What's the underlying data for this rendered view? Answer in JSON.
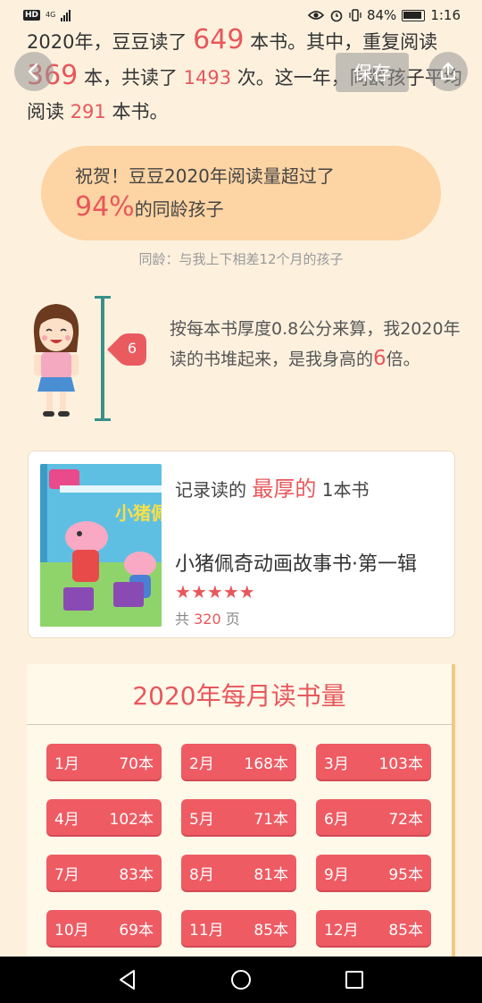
{
  "status_bar": {
    "hd": "HD",
    "network": "4G",
    "battery": "84%",
    "time": "1:16"
  },
  "summary": {
    "p1": "2020年，豆豆读了",
    "total_books": "649",
    "p2": "本书。其中，重复阅读",
    "reread": "369",
    "p3": "本，共读了",
    "read_times": "1493",
    "p4": "次。这一年，同龄孩子平均阅读",
    "peer_avg": "291",
    "p5": "本书。"
  },
  "toolbar": {
    "save_label": "保存"
  },
  "congrats": {
    "line1": "祝贺！豆豆2020年阅读量超过了",
    "percent": "94%",
    "line2": "的同龄孩子",
    "note": "同龄：与我上下相差12个月的孩子"
  },
  "height_stack": {
    "pin_value": "6",
    "text_before": "按每本书厚度0.8公分来算，我2020年读的书堆起来，是我身高的",
    "times": "6",
    "text_after": "倍。"
  },
  "thickest_book": {
    "prefix": "记录读的",
    "highlight": "最厚的",
    "suffix": "1本书",
    "title": "小猪佩奇动画故事书·第一辑",
    "rating": 5,
    "pages_prefix": "共",
    "pages": "320",
    "pages_suffix": "页",
    "cover_text": "小猪佩奇"
  },
  "monthly": {
    "title": "2020年每月读书量",
    "months": [
      {
        "month": "1月",
        "count": "70本"
      },
      {
        "month": "2月",
        "count": "168本"
      },
      {
        "month": "3月",
        "count": "103本"
      },
      {
        "month": "4月",
        "count": "102本"
      },
      {
        "month": "5月",
        "count": "71本"
      },
      {
        "month": "6月",
        "count": "72本"
      },
      {
        "month": "7月",
        "count": "83本"
      },
      {
        "month": "8月",
        "count": "81本"
      },
      {
        "month": "9月",
        "count": "95本"
      },
      {
        "month": "10月",
        "count": "69本"
      },
      {
        "month": "11月",
        "count": "85本"
      },
      {
        "month": "12月",
        "count": "85本"
      }
    ]
  },
  "colors": {
    "accent": "#e8575c",
    "background": "#fdf1de",
    "bubble": "#fdd4a3",
    "pole": "#3a8f8a"
  },
  "icons": {
    "back": "back-arrow-icon",
    "share": "share-icon",
    "nav_back": "nav-back-icon",
    "nav_home": "nav-home-icon",
    "nav_recent": "nav-recent-icon"
  }
}
